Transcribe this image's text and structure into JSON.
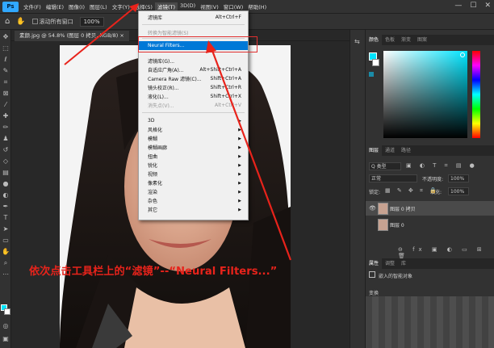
{
  "menubar": {
    "logo": "Ps",
    "items": [
      "文件(F)",
      "编辑(E)",
      "图像(I)",
      "图层(L)",
      "文字(Y)",
      "选择(S)",
      "滤镜(T)",
      "3D(D)",
      "视图(V)",
      "窗口(W)",
      "帮助(H)"
    ],
    "active_index": 6,
    "window_controls": [
      "—",
      "☐",
      "✕"
    ]
  },
  "options": {
    "scroll_all_label": "滚动所有窗口",
    "zoom_value": "100%"
  },
  "document": {
    "tab_title": "素颜.jpg @ 54.8% (图层 0 拷贝, RGB/8) ×"
  },
  "filter_menu": {
    "items": [
      {
        "label": "滤镜库",
        "shortcut": "Alt+Ctrl+F",
        "disabled": false,
        "submenu": false,
        "highlight": false
      },
      {
        "label": "转换为智能滤镜(S)",
        "shortcut": "",
        "disabled": true,
        "submenu": false,
        "highlight": false
      },
      {
        "label": "Neural Filters...",
        "shortcut": "",
        "disabled": false,
        "submenu": false,
        "highlight": true
      },
      {
        "label": "滤镜库(G)...",
        "shortcut": "",
        "disabled": false,
        "submenu": false,
        "highlight": false
      },
      {
        "label": "自适应广角(A)...",
        "shortcut": "Alt+Shift+Ctrl+A",
        "disabled": false,
        "submenu": false,
        "highlight": false
      },
      {
        "label": "Camera Raw 滤镜(C)...",
        "shortcut": "Shift+Ctrl+A",
        "disabled": false,
        "submenu": false,
        "highlight": false
      },
      {
        "label": "镜头校正(R)...",
        "shortcut": "Shift+Ctrl+R",
        "disabled": false,
        "submenu": false,
        "highlight": false
      },
      {
        "label": "液化(L)...",
        "shortcut": "Shift+Ctrl+X",
        "disabled": false,
        "submenu": false,
        "highlight": false
      },
      {
        "label": "消失点(V)...",
        "shortcut": "Alt+Ctrl+V",
        "disabled": true,
        "submenu": false,
        "highlight": false
      },
      {
        "label": "3D",
        "shortcut": "",
        "disabled": false,
        "submenu": true,
        "highlight": false
      },
      {
        "label": "风格化",
        "shortcut": "",
        "disabled": false,
        "submenu": true,
        "highlight": false
      },
      {
        "label": "模糊",
        "shortcut": "",
        "disabled": false,
        "submenu": true,
        "highlight": false
      },
      {
        "label": "模糊画廊",
        "shortcut": "",
        "disabled": false,
        "submenu": true,
        "highlight": false
      },
      {
        "label": "扭曲",
        "shortcut": "",
        "disabled": false,
        "submenu": true,
        "highlight": false
      },
      {
        "label": "锐化",
        "shortcut": "",
        "disabled": false,
        "submenu": true,
        "highlight": false
      },
      {
        "label": "视频",
        "shortcut": "",
        "disabled": false,
        "submenu": true,
        "highlight": false
      },
      {
        "label": "像素化",
        "shortcut": "",
        "disabled": false,
        "submenu": true,
        "highlight": false
      },
      {
        "label": "渲染",
        "shortcut": "",
        "disabled": false,
        "submenu": true,
        "highlight": false
      },
      {
        "label": "杂色",
        "shortcut": "",
        "disabled": false,
        "submenu": true,
        "highlight": false
      },
      {
        "label": "其它",
        "shortcut": "",
        "disabled": false,
        "submenu": true,
        "highlight": false
      }
    ]
  },
  "color_panel": {
    "tabs": [
      "颜色",
      "色板",
      "渐变",
      "图案"
    ],
    "foreground": "#00e5ff"
  },
  "layers_panel": {
    "tabs": [
      "图层",
      "通道",
      "路径"
    ],
    "kind_filter": "Q 类型",
    "blend_mode": "正常",
    "opacity_label": "不透明度:",
    "opacity_value": "100%",
    "lock_label": "锁定:",
    "fill_label": "填充:",
    "fill_value": "100%",
    "layers": [
      {
        "name": "图层 0 拷贝",
        "selected": true
      },
      {
        "name": "图层 0",
        "selected": false
      }
    ]
  },
  "properties_panel": {
    "tabs": [
      "属性",
      "调整",
      "库"
    ],
    "title": "嵌入的智能对象",
    "section": "变换"
  },
  "annotation": {
    "caption": "依次点击工具栏上的“滤镜”--“Neural Filters...”",
    "color": "#e8231b"
  }
}
